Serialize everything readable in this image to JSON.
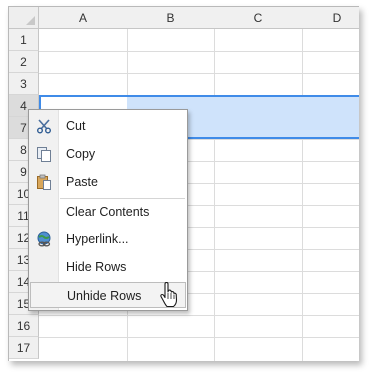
{
  "columns": [
    "A",
    "B",
    "C",
    "D"
  ],
  "rows": [
    "1",
    "2",
    "3",
    "4",
    "7",
    "8",
    "9",
    "10",
    "11",
    "12",
    "13",
    "14",
    "15",
    "16",
    "17"
  ],
  "selected_rows": [
    "4",
    "7"
  ],
  "context_menu": {
    "items": [
      {
        "label": "Cut",
        "icon": "scissors-icon"
      },
      {
        "label": "Copy",
        "icon": "copy-icon"
      },
      {
        "label": "Paste",
        "icon": "clipboard-icon"
      },
      {
        "label": "Clear Contents",
        "icon": ""
      },
      {
        "label": "Hyperlink...",
        "icon": "globe-link-icon"
      },
      {
        "label": "Hide Rows",
        "icon": ""
      },
      {
        "label": "Unhide Rows",
        "icon": ""
      }
    ],
    "hovered_item": "Unhide Rows"
  },
  "colors": {
    "selection_fill": "#cfe3fb",
    "selection_border": "#3f8be8",
    "header_bg": "#f0f0f0"
  }
}
